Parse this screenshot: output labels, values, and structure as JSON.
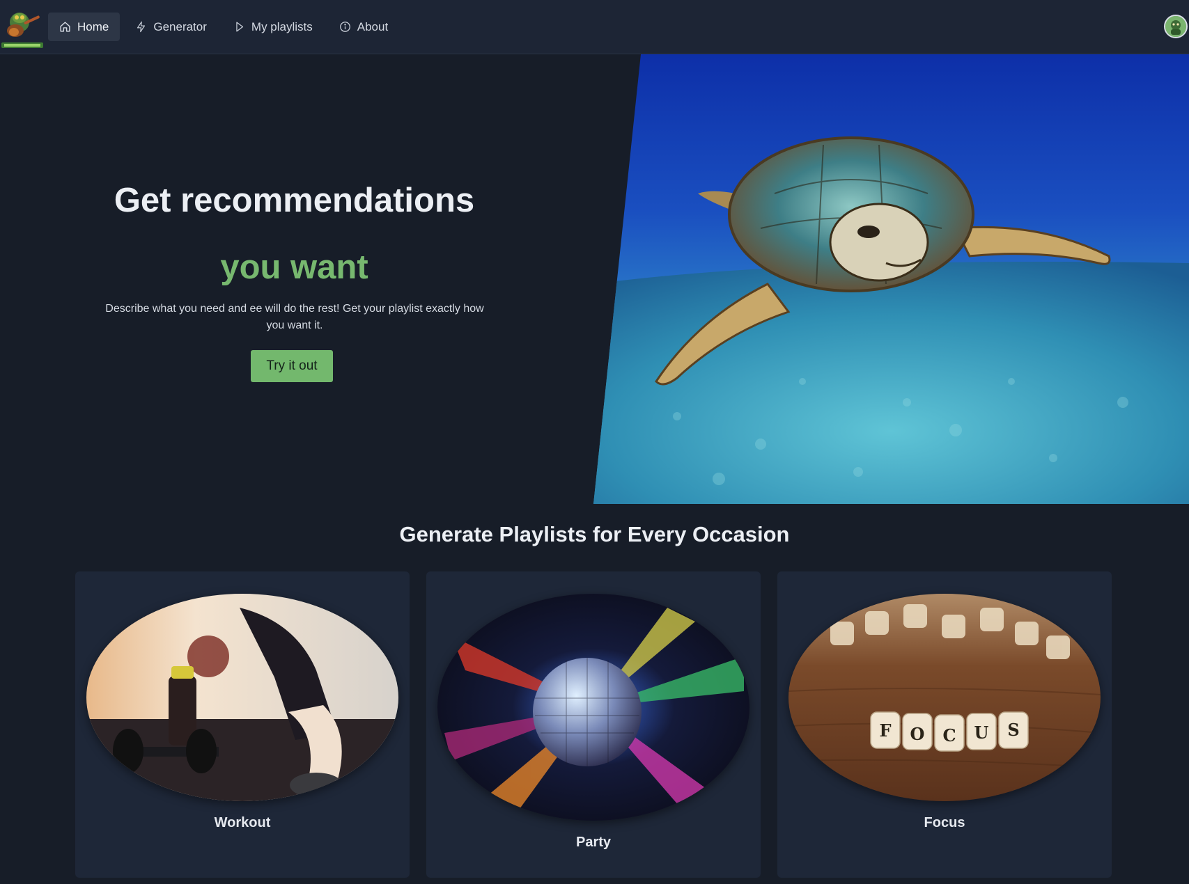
{
  "nav": {
    "logo": {
      "name": "app-logo"
    },
    "items": [
      {
        "label": "Home",
        "icon": "home-icon",
        "active": true
      },
      {
        "label": "Generator",
        "icon": "lightning-icon",
        "active": false
      },
      {
        "label": "My playlists",
        "icon": "play-icon",
        "active": false
      },
      {
        "label": "About",
        "icon": "info-icon",
        "active": false
      }
    ],
    "avatar": {
      "name": "user-avatar"
    }
  },
  "hero": {
    "title": "Get recommendations",
    "title_accent": "you want",
    "description": "Describe what you need and ee will do the rest! Get your playlist exactly how you want it.",
    "cta_label": "Try it out",
    "image": "sea-turtle-photo"
  },
  "occasions": {
    "title": "Generate Playlists for Every Occasion",
    "cards": [
      {
        "label": "Workout",
        "image": "workout-photo"
      },
      {
        "label": "Party",
        "image": "disco-ball-photo"
      },
      {
        "label": "Focus",
        "image": "focus-dice-photo"
      }
    ]
  },
  "colors": {
    "background": "#171d28",
    "navbar": "#1d2535",
    "card": "#1e2738",
    "accent": "#77b86f",
    "button": "#73b86d"
  }
}
